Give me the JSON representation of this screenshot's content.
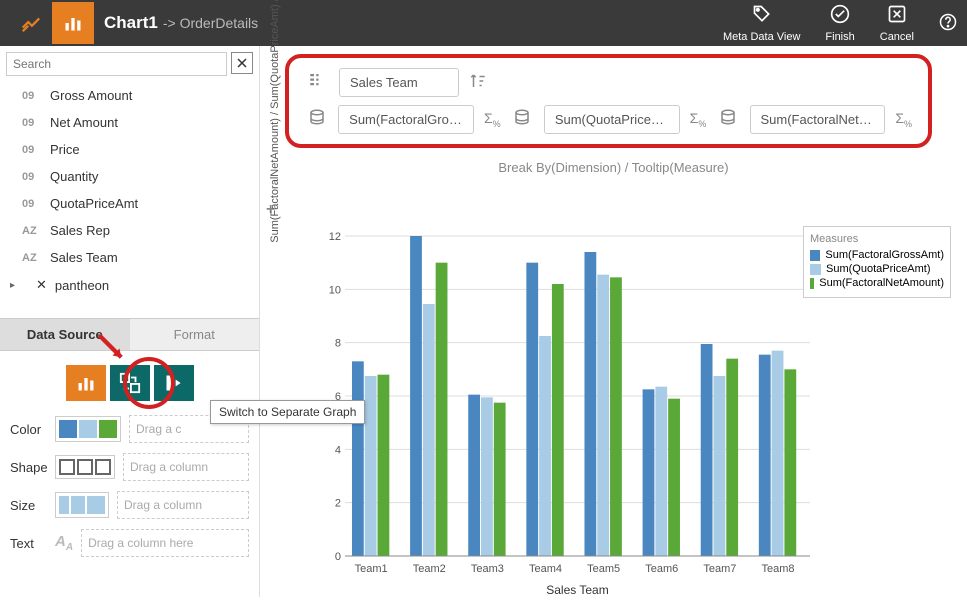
{
  "header": {
    "title": "Chart1",
    "subtitle": "-> OrderDetails",
    "actions": {
      "meta": "Meta Data View",
      "finish": "Finish",
      "cancel": "Cancel"
    }
  },
  "search": {
    "placeholder": "Search"
  },
  "fields": [
    {
      "type": "09",
      "name": "Gross Amount"
    },
    {
      "type": "09",
      "name": "Net Amount"
    },
    {
      "type": "09",
      "name": "Price"
    },
    {
      "type": "09",
      "name": "Quantity"
    },
    {
      "type": "09",
      "name": "QuotaPriceAmt"
    },
    {
      "type": "AZ",
      "name": "Sales Rep"
    },
    {
      "type": "AZ",
      "name": "Sales Team"
    },
    {
      "type": "",
      "name": "pantheon",
      "expand": true
    }
  ],
  "tabs": {
    "data_source": "Data Source",
    "format": "Format"
  },
  "tooltip": "Switch to Separate Graph",
  "encodings": {
    "color": {
      "label": "Color",
      "drop": "Drag a c"
    },
    "shape": {
      "label": "Shape",
      "drop": "Drag a column"
    },
    "size": {
      "label": "Size",
      "drop": "Drag a column"
    },
    "text": {
      "label": "Text",
      "drop": "Drag a column here"
    }
  },
  "config": {
    "dimension": "Sales Team",
    "measures": [
      "Sum(FactoralGross...",
      "Sum(QuotaPriceA...",
      "Sum(FactoralNetA..."
    ]
  },
  "break_label": "Break By(Dimension) / Tooltip(Measure)",
  "chart_data": {
    "type": "bar",
    "title": "",
    "xlabel": "Sales Team",
    "ylabel": "Sum(FactoralNetAmount) / Sum(QuotaPriceAmt) / Sum(FactoralGros.",
    "ylim": [
      0,
      12
    ],
    "categories": [
      "Team1",
      "Team2",
      "Team3",
      "Team4",
      "Team5",
      "Team6",
      "Team7",
      "Team8"
    ],
    "series": [
      {
        "name": "Sum(FactoralGrossAmt)",
        "color": "#4a87c0",
        "values": [
          7.3,
          12.0,
          6.05,
          11.0,
          11.4,
          6.25,
          7.95,
          7.55
        ]
      },
      {
        "name": "Sum(QuotaPriceAmt)",
        "color": "#a8cbe6",
        "values": [
          6.75,
          9.45,
          5.95,
          8.25,
          10.55,
          6.35,
          6.75,
          7.7
        ]
      },
      {
        "name": "Sum(FactoralNetAmount)",
        "color": "#5aa838",
        "values": [
          6.8,
          11.0,
          5.75,
          10.2,
          10.45,
          5.9,
          7.4,
          7.0
        ]
      }
    ],
    "legend_title": "Measures"
  }
}
